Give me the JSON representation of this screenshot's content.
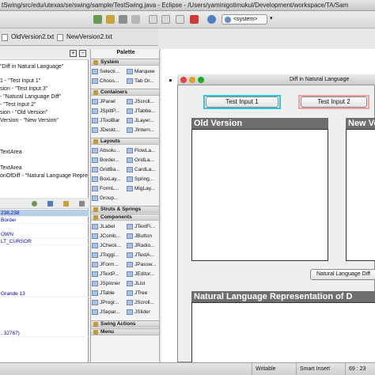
{
  "window": {
    "title": "tSwing/src/edu/utexas/se/swing/sample/TestSwing.java - Eclipse - /Users/yaminigotimukul/Development/workspace/TA/Sam"
  },
  "editor_tabs": [
    {
      "label": "OldVersion2.txt"
    },
    {
      "label": "NewVersion2.txt"
    }
  ],
  "toolbar": {
    "system_combo": "<system>"
  },
  "outline": {
    "items": [
      "\"Diff in Natural Language\"",
      "1 - \"Test Input 1\"",
      "sion - \"Test Input 3\"",
      "- \"Natural Language Diff\"",
      "- \"Test Input 2\"",
      "sion - \"Old Version\"",
      "Version - \"New Version\"",
      "TextArea",
      "TextArea",
      "onOfDiff - \"Natural Language Repre"
    ]
  },
  "properties": {
    "rows": [
      {
        "text": "238,238",
        "selected": true
      },
      {
        "text": "Border",
        "selected": false
      },
      {
        "text": "OWN",
        "selected": false
      },
      {
        "text": "LT_CURSOR",
        "selected": false
      },
      {
        "text": "Grande 13",
        "selected": false
      },
      {
        "text": ", 32767)",
        "selected": false
      }
    ]
  },
  "palette": {
    "title": "Palette",
    "sections": {
      "system": "System",
      "containers": "Containers",
      "layouts": "Layouts",
      "struts": "Struts & Springs",
      "components": "Components",
      "swing_actions": "Swing Actions",
      "menu": "Menu"
    },
    "system_items": [
      "Selecti...",
      "Marquee",
      "Choos...",
      "Tab Or..."
    ],
    "container_items": [
      "JPanel",
      "JScroll...",
      "JSplitP...",
      "JTabbe...",
      "JToolBar",
      "JLayer...",
      "JDeskt...",
      "JIntern..."
    ],
    "layout_items": [
      "Absolu...",
      "FlowLa...",
      "Border...",
      "GridLa...",
      "GridBa...",
      "CardLa...",
      "BoxLay...",
      "Spring...",
      "FormL...",
      "MigLay...",
      "Group..."
    ],
    "component_items": [
      "JLabel",
      "JTextFi...",
      "JComb...",
      "JButton",
      "JCheck...",
      "JRadio...",
      "JToggl...",
      "JTextA...",
      "JForm...",
      "JPassw...",
      "JTextP...",
      "JEditor...",
      "JSpinner",
      "JList",
      "JTable",
      "JTree",
      "JProgr...",
      "JScroll...",
      "JSepar...",
      "JSlider"
    ]
  },
  "design": {
    "frame_title": "Diff in Natural Language",
    "button1": "Test Input 1",
    "button2": "Test Input 2",
    "old_version_label": "Old Version",
    "new_version_label": "New Version",
    "diff_button": "Natural Language Diff",
    "nl_label": "Natural Language Representation of D"
  },
  "status": {
    "writable": "Writable",
    "insert_mode": "Smart Insert",
    "position": "69 : 23"
  }
}
